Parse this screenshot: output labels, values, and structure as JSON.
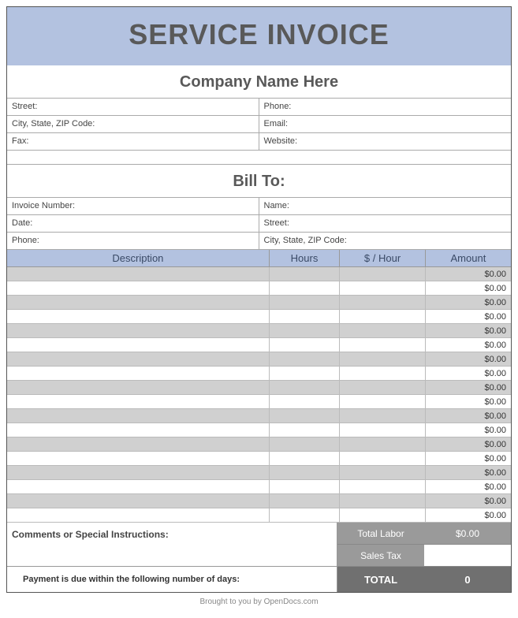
{
  "title": "SERVICE INVOICE",
  "company_name": "Company Name Here",
  "company_fields": {
    "left": [
      "Street:",
      "City, State, ZIP Code:",
      "Fax:"
    ],
    "right": [
      "Phone:",
      "Email:",
      "Website:"
    ]
  },
  "bill_to_header": "Bill To:",
  "bill_to_fields": {
    "left": [
      "Invoice Number:",
      "Date:",
      "Phone:"
    ],
    "right": [
      "Name:",
      "Street:",
      "City, State, ZIP Code:"
    ]
  },
  "columns": {
    "description": "Description",
    "hours": "Hours",
    "rate": "$ / Hour",
    "amount": "Amount"
  },
  "line_items": [
    {
      "description": "",
      "hours": "",
      "rate": "",
      "amount": "$0.00"
    },
    {
      "description": "",
      "hours": "",
      "rate": "",
      "amount": "$0.00"
    },
    {
      "description": "",
      "hours": "",
      "rate": "",
      "amount": "$0.00"
    },
    {
      "description": "",
      "hours": "",
      "rate": "",
      "amount": "$0.00"
    },
    {
      "description": "",
      "hours": "",
      "rate": "",
      "amount": "$0.00"
    },
    {
      "description": "",
      "hours": "",
      "rate": "",
      "amount": "$0.00"
    },
    {
      "description": "",
      "hours": "",
      "rate": "",
      "amount": "$0.00"
    },
    {
      "description": "",
      "hours": "",
      "rate": "",
      "amount": "$0.00"
    },
    {
      "description": "",
      "hours": "",
      "rate": "",
      "amount": "$0.00"
    },
    {
      "description": "",
      "hours": "",
      "rate": "",
      "amount": "$0.00"
    },
    {
      "description": "",
      "hours": "",
      "rate": "",
      "amount": "$0.00"
    },
    {
      "description": "",
      "hours": "",
      "rate": "",
      "amount": "$0.00"
    },
    {
      "description": "",
      "hours": "",
      "rate": "",
      "amount": "$0.00"
    },
    {
      "description": "",
      "hours": "",
      "rate": "",
      "amount": "$0.00"
    },
    {
      "description": "",
      "hours": "",
      "rate": "",
      "amount": "$0.00"
    },
    {
      "description": "",
      "hours": "",
      "rate": "",
      "amount": "$0.00"
    },
    {
      "description": "",
      "hours": "",
      "rate": "",
      "amount": "$0.00"
    },
    {
      "description": "",
      "hours": "",
      "rate": "",
      "amount": "$0.00"
    }
  ],
  "comments_label": "Comments or Special Instructions:",
  "payment_terms": "Payment is due within the following number of days:",
  "summary": {
    "total_labor_label": "Total Labor",
    "total_labor_value": "$0.00",
    "sales_tax_label": "Sales Tax",
    "sales_tax_value": "",
    "total_label": "TOTAL",
    "total_value": "0"
  },
  "footer": "Brought to you by OpenDocs.com"
}
